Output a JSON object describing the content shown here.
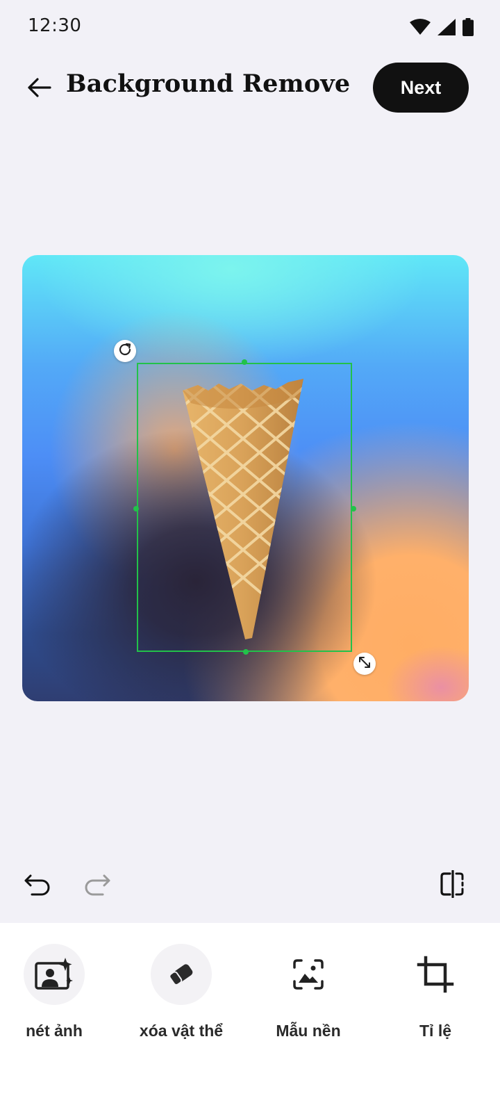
{
  "status_bar": {
    "time": "12:30",
    "icons": [
      "wifi-icon",
      "signal-icon",
      "battery-icon"
    ]
  },
  "header": {
    "title": "Background Remove",
    "back_icon": "arrow-left-icon",
    "next_label": "Next"
  },
  "editor": {
    "object": "ice cream cone",
    "rotate_icon": "rotate-icon",
    "resize_icon": "resize-diagonal-icon",
    "selection_color": "#22c24a"
  },
  "history": {
    "undo_icon": "undo-icon",
    "redo_icon": "redo-icon",
    "compare_icon": "compare-split-icon"
  },
  "toolbar": {
    "items": [
      {
        "label": "nét ảnh",
        "icon": "portrait-sparkle-icon"
      },
      {
        "label": "xóa vật thể",
        "icon": "eraser-icon"
      },
      {
        "label": "Mẫu nền",
        "icon": "background-image-icon"
      },
      {
        "label": "Tỉ lệ",
        "icon": "crop-icon"
      }
    ]
  },
  "colors": {
    "background": "#f2f1f7",
    "primary_button": "#111111",
    "toolbar_bg": "#ffffff"
  }
}
